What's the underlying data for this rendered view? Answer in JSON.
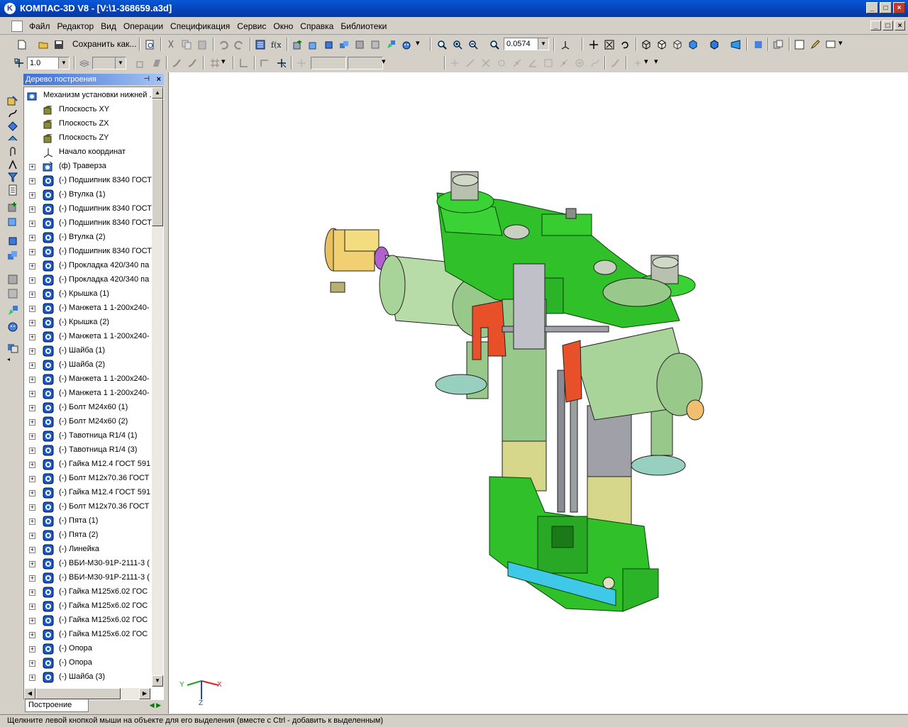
{
  "window": {
    "title": "КОМПАС-3D V8 - [V:\\1-368659.a3d]"
  },
  "menu": [
    "Файл",
    "Редактор",
    "Вид",
    "Операции",
    "Спецификация",
    "Сервис",
    "Окно",
    "Справка",
    "Библиотеки"
  ],
  "toolbar": {
    "save_as_label": "Сохранить как...",
    "zoom_value": "0.0574",
    "step_value": "1.0"
  },
  "tree_panel": {
    "title": "Дерево построения",
    "tab_label": "Построение",
    "items": [
      {
        "label": "Механизм установки нижней ...",
        "icon": "assembly-root-icon",
        "expandable": false
      },
      {
        "label": "Плоскость XY",
        "icon": "plane-icon",
        "expandable": false
      },
      {
        "label": "Плоскость ZX",
        "icon": "plane-icon",
        "expandable": false
      },
      {
        "label": "Плоскость ZY",
        "icon": "plane-icon",
        "expandable": false
      },
      {
        "label": "Начало координат",
        "icon": "origin-icon",
        "expandable": false
      },
      {
        "label": "(ф) Траверза",
        "icon": "subassembly-icon",
        "expandable": true
      },
      {
        "label": "(-) Подшипник 8340 ГОСТ",
        "icon": "part-icon",
        "expandable": true
      },
      {
        "label": "(-) Втулка (1)",
        "icon": "part-icon",
        "expandable": true
      },
      {
        "label": "(-) Подшипник 8340 ГОСТ",
        "icon": "part-icon",
        "expandable": true
      },
      {
        "label": "(-) Подшипник 8340 ГОСТ",
        "icon": "part-icon",
        "expandable": true
      },
      {
        "label": "(-) Втулка (2)",
        "icon": "part-icon",
        "expandable": true
      },
      {
        "label": "(-) Подшипник 8340 ГОСТ",
        "icon": "part-icon",
        "expandable": true
      },
      {
        "label": "(-) Прокладка 420/340 па",
        "icon": "part-icon",
        "expandable": true
      },
      {
        "label": "(-) Прокладка 420/340 па",
        "icon": "part-icon",
        "expandable": true
      },
      {
        "label": "(-) Крышка (1)",
        "icon": "part-icon",
        "expandable": true
      },
      {
        "label": "(-) Манжета 1 1-200x240-",
        "icon": "part-icon",
        "expandable": true
      },
      {
        "label": "(-) Крышка (2)",
        "icon": "part-icon",
        "expandable": true
      },
      {
        "label": "(-) Манжета 1 1-200x240-",
        "icon": "part-icon",
        "expandable": true
      },
      {
        "label": "(-) Шайба (1)",
        "icon": "part-icon",
        "expandable": true
      },
      {
        "label": "(-) Шайба (2)",
        "icon": "part-icon",
        "expandable": true
      },
      {
        "label": "(-) Манжета 1 1-200x240-",
        "icon": "part-icon",
        "expandable": true
      },
      {
        "label": "(-) Манжета 1 1-200x240-",
        "icon": "part-icon",
        "expandable": true
      },
      {
        "label": "(-) Болт М24x60 (1)",
        "icon": "part-icon",
        "expandable": true
      },
      {
        "label": "(-) Болт М24x60 (2)",
        "icon": "part-icon",
        "expandable": true
      },
      {
        "label": "(-) Тавотница R1/4 (1)",
        "icon": "part-icon",
        "expandable": true
      },
      {
        "label": "(-) Тавотница R1/4 (3)",
        "icon": "part-icon",
        "expandable": true
      },
      {
        "label": "(-) Гайка М12.4 ГОСТ 591",
        "icon": "part-icon",
        "expandable": true
      },
      {
        "label": "(-) Болт М12x70.36 ГОСТ",
        "icon": "part-icon",
        "expandable": true
      },
      {
        "label": "(-) Гайка М12.4 ГОСТ 591",
        "icon": "part-icon",
        "expandable": true
      },
      {
        "label": "(-) Болт М12x70.36 ГОСТ",
        "icon": "part-icon",
        "expandable": true
      },
      {
        "label": "(-) Пята (1)",
        "icon": "part-icon",
        "expandable": true
      },
      {
        "label": "(-) Пята (2)",
        "icon": "part-icon",
        "expandable": true
      },
      {
        "label": "(-) Линейка",
        "icon": "part-icon",
        "expandable": true
      },
      {
        "label": "(-) ВБИ-М30-91Р-2111-3 (",
        "icon": "part-icon",
        "expandable": true
      },
      {
        "label": "(-) ВБИ-М30-91Р-2111-3 (",
        "icon": "part-icon",
        "expandable": true
      },
      {
        "label": "(-) Гайка М125x6.02 ГОС",
        "icon": "part-icon",
        "expandable": true
      },
      {
        "label": "(-) Гайка М125x6.02 ГОС",
        "icon": "part-icon",
        "expandable": true
      },
      {
        "label": "(-) Гайка М125x6.02 ГОС",
        "icon": "part-icon",
        "expandable": true
      },
      {
        "label": "(-) Гайка М125x6.02 ГОС",
        "icon": "part-icon",
        "expandable": true
      },
      {
        "label": "(-) Опора",
        "icon": "part-icon",
        "expandable": true
      },
      {
        "label": "(-) Опора",
        "icon": "part-icon",
        "expandable": true
      },
      {
        "label": "(-) Шайба (3)",
        "icon": "part-icon",
        "expandable": true
      }
    ]
  },
  "axes_indicator": {
    "x": "X",
    "y": "Y",
    "z": "Z"
  },
  "status": {
    "text": "Щелкните левой кнопкой мыши на объекте для его выделения (вместе с Ctrl - добавить к выделенным)"
  },
  "colors": {
    "title_bar": "#0a58d6",
    "model_green": "#2fc02a",
    "model_light_green": "#a8d89a",
    "model_red": "#e8502a",
    "model_gray": "#a0a0a8",
    "model_khaki": "#d6d78a",
    "model_cyan": "#40c8e8",
    "motor_yellow": "#f0d070"
  }
}
